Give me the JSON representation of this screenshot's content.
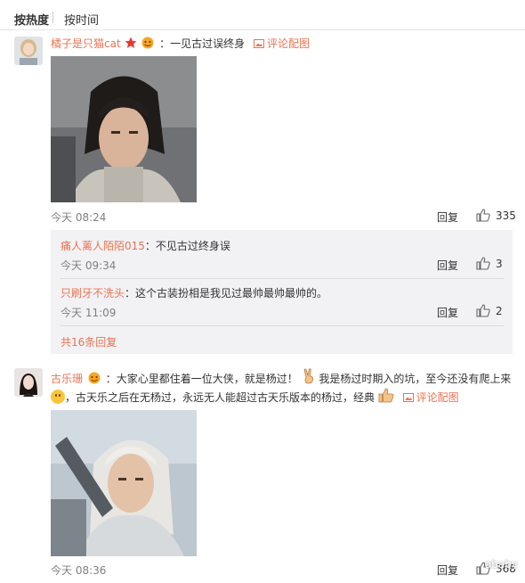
{
  "sort": {
    "hot": "按热度",
    "time": "按时间"
  },
  "comments": [
    {
      "user": "橘子是只猫cat",
      "sep": "：",
      "text": "一见古过误终身",
      "pic_link": "评论配图",
      "time": "今天 08:24",
      "reply": "回复",
      "likes": "335",
      "replies": [
        {
          "user": "痛人蓠人陌陌015",
          "sep": "：",
          "text": "不见古过终身误",
          "time": "今天 09:34",
          "reply": "回复",
          "likes": "3"
        },
        {
          "user": "只刷牙不洗头",
          "sep": "：",
          "text": "这个古装扮相是我见过最帅最帅最帅的。",
          "time": "今天 11:09",
          "reply": "回复",
          "likes": "2"
        }
      ],
      "more_replies": "共16条回复"
    },
    {
      "user": "古乐珊",
      "sep": "：",
      "text_line1": "大家心里都住着一位大侠，就是杨过！",
      "text_line1b": "我是杨过时期入的坑，至今还没有爬上来",
      "text_line2": "，古天乐之后在无杨过，永远无人能超过古天乐版本的杨过，经典",
      "pic_link": "评论配图",
      "time": "今天 08:36",
      "reply": "回复",
      "likes": "368"
    }
  ],
  "watermark": "ababy",
  "colors": {
    "accent": "#eb7350",
    "time": "#808080",
    "reply_bg": "#f2f2f5"
  }
}
